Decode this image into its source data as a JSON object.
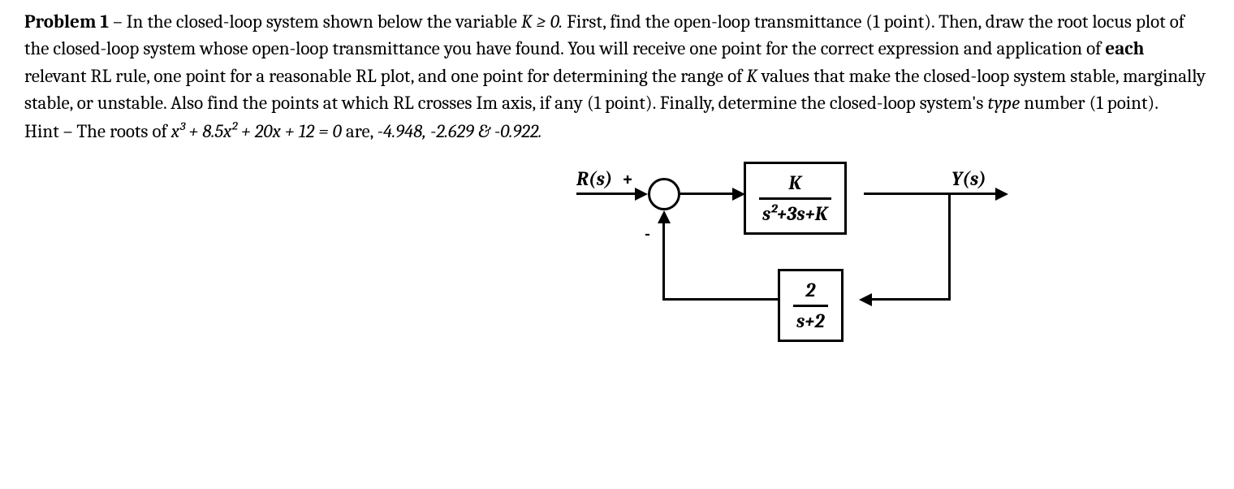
{
  "problem": {
    "label": "Problem 1",
    "dash": " – ",
    "p1a": "In the closed-loop system shown below the variable ",
    "kc": "K ≥ 0.",
    "p1b": " First, find the open-loop transmittance (1 point). Then, draw the root locus plot of the closed-loop system whose open-loop transmittance you have found. You will receive one point for the correct expression and application of ",
    "each": "each",
    "p1c": " relevant RL rule, one point for a reasonable RL plot, and one point for determining the range of ",
    "kvar": "K",
    "p1d": " values that make the closed-loop system stable, marginally stable, or unstable. Also find the points at which RL crosses Im axis, if any (1 point). Finally, determine the closed-loop system's ",
    "type": "type",
    "p1e": " number (1 point)."
  },
  "hint": {
    "label": "Hint – ",
    "text1": "The roots of ",
    "poly": "x³ + 8.5x² + 20x + 12 = 0",
    "text2": " are, ",
    "roots": "-4.948, -2.629 & -0.922."
  },
  "diagram": {
    "input": "R(s)",
    "plus": "+",
    "minus": "-",
    "output": "Y(s)",
    "forward_num": "K",
    "forward_den": "s²+3s+K",
    "feedback_num": "2",
    "feedback_den": "s+2"
  }
}
